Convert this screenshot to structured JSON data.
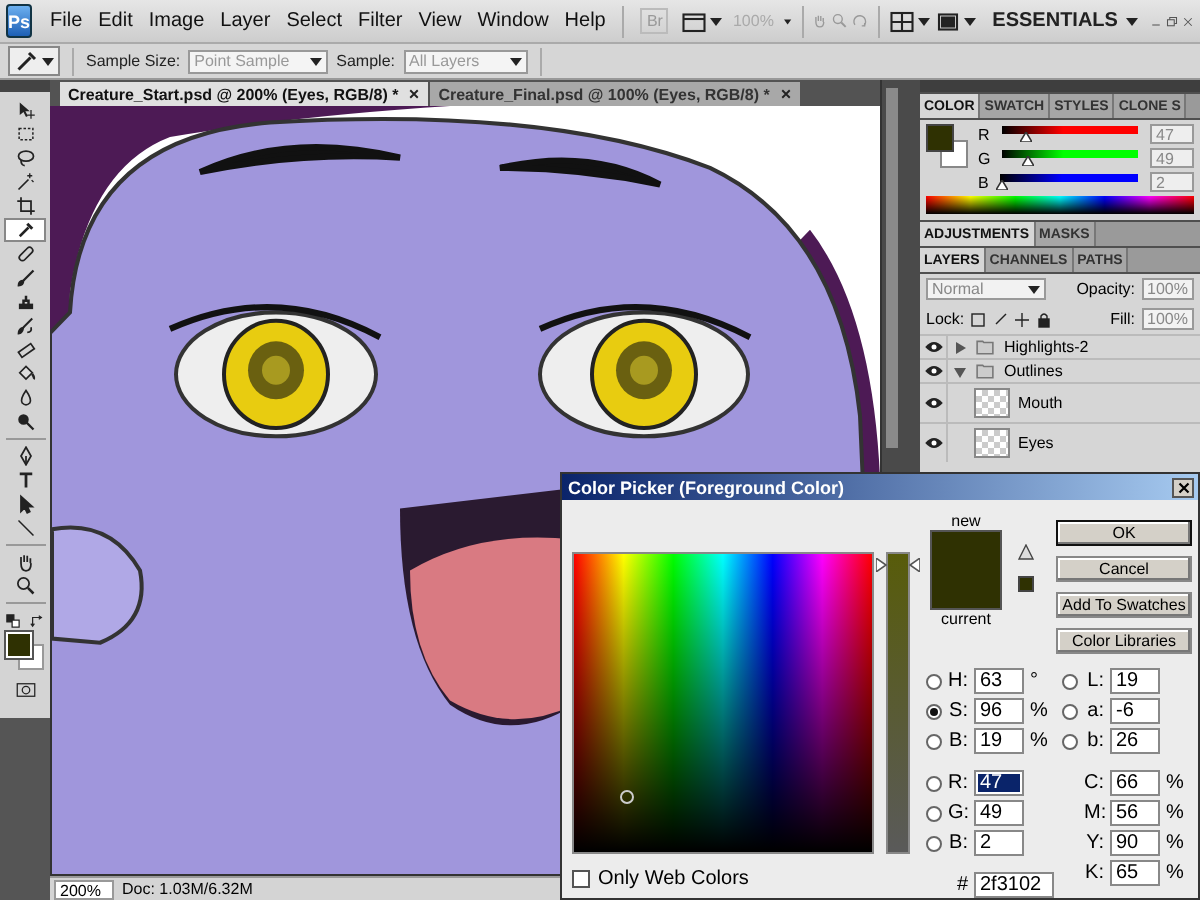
{
  "menu_bar": {
    "logo": "Ps",
    "items": [
      "File",
      "Edit",
      "Image",
      "Layer",
      "Select",
      "Filter",
      "View",
      "Window",
      "Help"
    ],
    "bridge_button": "Br",
    "zoom": {
      "value": "100%",
      "disabled": true
    },
    "workspace": "ESSENTIALS"
  },
  "options_bar": {
    "sample_size": {
      "label": "Sample Size:",
      "value": "Point Sample",
      "disabled": true
    },
    "sample": {
      "label": "Sample:",
      "value": "All Layers",
      "disabled": true
    }
  },
  "tools": [
    {
      "kind": "move",
      "selected": false
    },
    {
      "kind": "marquee",
      "selected": false
    },
    {
      "kind": "lasso",
      "selected": false
    },
    {
      "kind": "wand",
      "selected": false
    },
    {
      "kind": "crop",
      "selected": false
    },
    {
      "kind": "eyedropper",
      "selected": true
    },
    {
      "kind": "healing",
      "selected": false
    },
    {
      "kind": "brush",
      "selected": false
    },
    {
      "kind": "stamp",
      "selected": false
    },
    {
      "kind": "history",
      "selected": false
    },
    {
      "kind": "eraser",
      "selected": false
    },
    {
      "kind": "bucket",
      "selected": false
    },
    {
      "kind": "blur",
      "selected": false
    },
    {
      "kind": "dodge",
      "selected": false
    },
    {
      "kind": "pen",
      "selected": false
    },
    {
      "kind": "type",
      "selected": false
    },
    {
      "kind": "path",
      "selected": false
    },
    {
      "kind": "line",
      "selected": false
    },
    {
      "kind": "hand",
      "selected": false
    },
    {
      "kind": "zoom",
      "selected": false
    }
  ],
  "document_tabs": [
    {
      "label": "Creature_Start.psd @ 200% (Eyes, RGB/8) *",
      "selected": true
    },
    {
      "label": "Creature_Final.psd @ 100% (Eyes, RGB/8) *",
      "selected": false
    }
  ],
  "status_bar": {
    "zoom": "200%",
    "doc_size": "Doc: 1.03M/6.32M"
  },
  "color_panel": {
    "tabs": [
      {
        "label": "COLOR",
        "selected": true
      },
      {
        "label": "SWATCH",
        "selected": false
      },
      {
        "label": "STYLES",
        "selected": false
      },
      {
        "label": "CLONE S",
        "selected": false
      }
    ],
    "channels": [
      {
        "name": "R",
        "value": "47",
        "level": 0.184,
        "color": "#ff0000"
      },
      {
        "name": "G",
        "value": "49",
        "level": 0.192,
        "color": "#00ff00"
      },
      {
        "name": "B",
        "value": "2",
        "level": 0.008,
        "color": "#0000ff"
      }
    ]
  },
  "adjustments_panel": {
    "tabs": [
      {
        "label": "ADJUSTMENTS",
        "selected": true
      },
      {
        "label": "MASKS",
        "selected": false
      }
    ]
  },
  "layers_panel": {
    "tabs": [
      {
        "label": "LAYERS",
        "selected": true
      },
      {
        "label": "CHANNELS",
        "selected": false
      },
      {
        "label": "PATHS",
        "selected": false
      }
    ],
    "blend_mode": "Normal",
    "opacity": {
      "label": "Opacity:",
      "value": "100%"
    },
    "lock_label": "Lock:",
    "fill": {
      "label": "Fill:",
      "value": "100%"
    },
    "layers": [
      {
        "name": "Highlights-2",
        "kind": "group",
        "visible": true,
        "expanded": false
      },
      {
        "name": "Outlines",
        "kind": "group",
        "visible": true,
        "expanded": true,
        "children": [
          {
            "name": "Mouth",
            "kind": "layer",
            "visible": true
          },
          {
            "name": "Eyes",
            "kind": "layer",
            "visible": true
          }
        ]
      }
    ]
  },
  "color_picker": {
    "title": "Color Picker (Foreground Color)",
    "buttons": [
      {
        "label": "OK",
        "default": true
      },
      {
        "label": "Cancel",
        "default": false
      },
      {
        "label": "Add To Swatches",
        "default": false
      },
      {
        "label": "Color Libraries",
        "default": false
      }
    ],
    "new_label": "new",
    "current_label": "current",
    "hsb_rgb_fields": [
      {
        "label": "H:",
        "value": "63",
        "unit": "°",
        "kind": "radio",
        "selected": false,
        "focused": false
      },
      {
        "label": "S:",
        "value": "96",
        "unit": "%",
        "kind": "radio",
        "selected": true,
        "focused": false
      },
      {
        "label": "B:",
        "value": "19",
        "unit": "%",
        "kind": "radio",
        "selected": false,
        "focused": false
      },
      {
        "label": "R:",
        "value": "47",
        "kind": "radio",
        "selected": false,
        "focused": true
      },
      {
        "label": "G:",
        "value": "49",
        "kind": "radio",
        "selected": false,
        "focused": false
      },
      {
        "label": "B:",
        "value": "2",
        "kind": "radio",
        "selected": false,
        "focused": false
      }
    ],
    "lab_cmyk_fields": [
      {
        "label": "L:",
        "value": "19",
        "kind": "radio",
        "selected": false,
        "focused": false
      },
      {
        "label": "a:",
        "value": "-6",
        "kind": "radio",
        "selected": false,
        "focused": false
      },
      {
        "label": "b:",
        "value": "26",
        "kind": "radio",
        "selected": false,
        "focused": false
      },
      {
        "label": "C:",
        "value": "66",
        "unit": "%",
        "kind": "plain",
        "focused": false
      },
      {
        "label": "M:",
        "value": "56",
        "unit": "%",
        "kind": "plain",
        "focused": false
      },
      {
        "label": "Y:",
        "value": "90",
        "unit": "%",
        "kind": "plain",
        "focused": false
      },
      {
        "label": "K:",
        "value": "65",
        "unit": "%",
        "kind": "plain",
        "focused": false
      }
    ],
    "hex": {
      "label": "#",
      "value": "2f3102"
    },
    "saturation_slider": {
      "level": 0.96
    },
    "only_web_colors": {
      "label": "Only Web Colors",
      "checked": false
    }
  }
}
